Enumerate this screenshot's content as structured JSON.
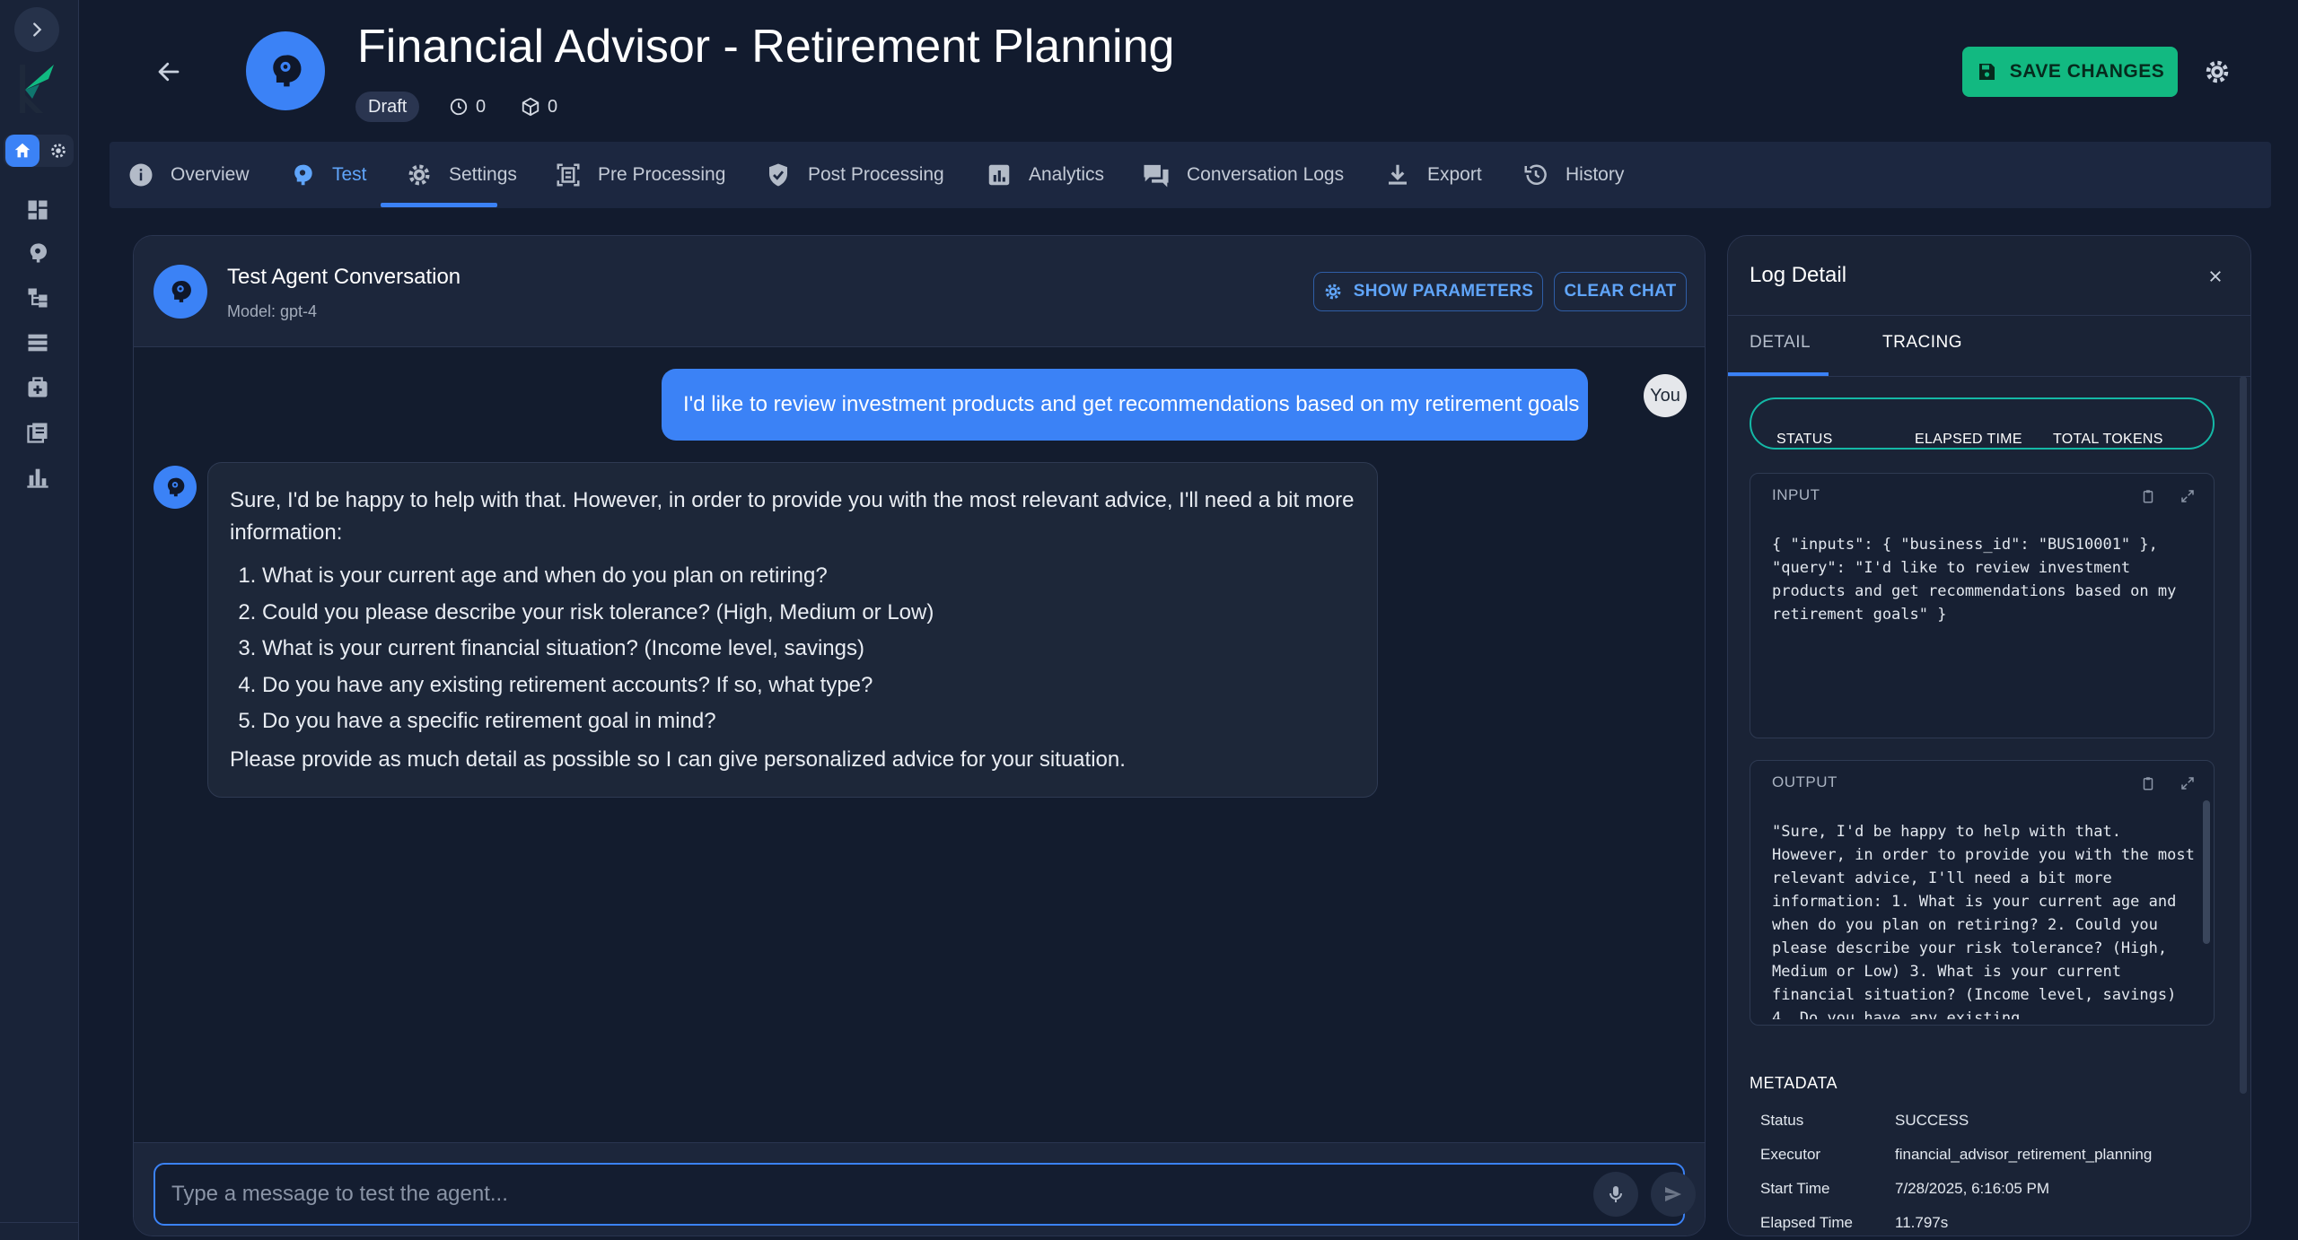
{
  "header": {
    "title": "Financial Advisor - Retirement Planning",
    "status_badge": "Draft",
    "runs_count": "0",
    "versions_count": "0",
    "save_label": "SAVE CHANGES"
  },
  "tabs": [
    {
      "label": "Overview",
      "icon": "info-icon"
    },
    {
      "label": "Test",
      "icon": "brain-icon"
    },
    {
      "label": "Settings",
      "icon": "gear-icon"
    },
    {
      "label": "Pre Processing",
      "icon": "frame-icon"
    },
    {
      "label": "Post Processing",
      "icon": "shield-check-icon"
    },
    {
      "label": "Analytics",
      "icon": "analytics-icon"
    },
    {
      "label": "Conversation Logs",
      "icon": "chat-icon"
    },
    {
      "label": "Export",
      "icon": "download-icon"
    },
    {
      "label": "History",
      "icon": "history-icon"
    }
  ],
  "active_tab": "Test",
  "chat": {
    "title": "Test Agent Conversation",
    "model": "Model: gpt-4",
    "show_params_label": "SHOW PARAMETERS",
    "clear_label": "CLEAR CHAT",
    "user_avatar": "You",
    "user_message": "I'd like to review investment products and get recommendations based on my retirement goals",
    "bot_intro": "Sure, I'd be happy to help with that. However, in order to provide you with the most relevant advice, I'll need a bit more information:",
    "bot_items": [
      "What is your current age and when do you plan on retiring?",
      "Could you please describe your risk tolerance? (High, Medium or Low)",
      "What is your current financial situation? (Income level, savings)",
      "Do you have any existing retirement accounts? If so, what type?",
      "Do you have a specific retirement goal in mind?"
    ],
    "bot_outro": "Please provide as much detail as possible so I can give personalized advice for your situation.",
    "input_placeholder": "Type a message to test the agent..."
  },
  "log": {
    "title": "Log Detail",
    "tab_detail": "DETAIL",
    "tab_tracing": "TRACING",
    "summary_status": "STATUS",
    "summary_elapsed": "ELAPSED TIME",
    "summary_tokens": "TOTAL TOKENS",
    "input_label": "INPUT",
    "input_text": "{ \"inputs\": { \"business_id\": \"BUS10001\" }, \"query\": \"I'd like to review investment products and get recommendations based on my retirement goals\" }",
    "output_label": "OUTPUT",
    "output_text": "\"Sure, I'd be happy to help with that. However, in order to provide you with the most relevant advice, I'll need a bit more information: 1. What is your current age and when do you plan on retiring? 2. Could you please describe your risk tolerance? (High, Medium or Low) 3. What is your current financial situation? (Income level, savings) 4. Do you have any existing",
    "metadata_title": "METADATA",
    "metadata": [
      {
        "key": "Status",
        "value": "SUCCESS"
      },
      {
        "key": "Executor",
        "value": "financial_advisor_retirement_planning"
      },
      {
        "key": "Start Time",
        "value": "7/28/2025, 6:16:05 PM"
      },
      {
        "key": "Elapsed Time",
        "value": "11.797s"
      }
    ]
  },
  "colors": {
    "background": "#121b2e",
    "accent": "#3b82f6",
    "save": "#12b981",
    "summary_border": "#14b8a6"
  }
}
